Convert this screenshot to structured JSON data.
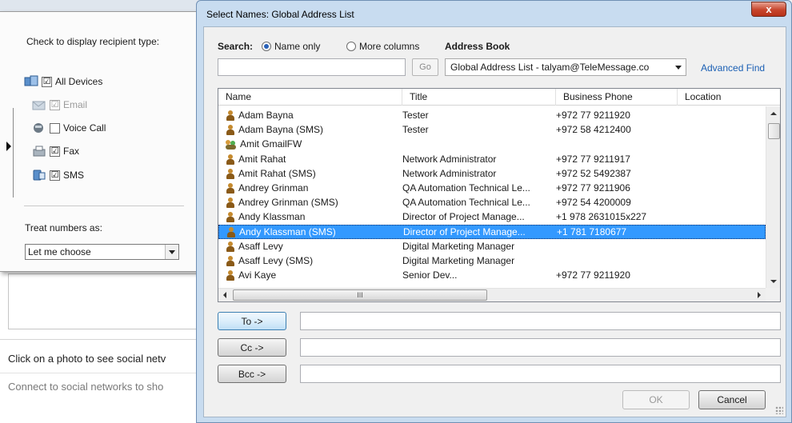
{
  "background": {
    "social_text": "Click on a photo to see social netv",
    "connect_text": "Connect to social networks to sho"
  },
  "recipient_popup": {
    "heading": "Check to display recipient type:",
    "types": [
      {
        "label": "All Devices",
        "checked": "☑",
        "icon": "devices-icon"
      },
      {
        "label": "Email",
        "checked": "☑",
        "icon": "email-icon",
        "dim": true
      },
      {
        "label": "Voice Call",
        "checked": "",
        "icon": "phone-icon"
      },
      {
        "label": "Fax",
        "checked": "☑",
        "icon": "fax-icon"
      },
      {
        "label": "SMS",
        "checked": "☑",
        "icon": "sms-icon"
      }
    ],
    "treat_label": "Treat numbers as:",
    "treat_value": "Let me choose"
  },
  "dialog": {
    "title": "Select Names: Global Address List",
    "close_label": "x",
    "search_label": "Search:",
    "radio_name_only": "Name only",
    "radio_more_columns": "More columns",
    "address_book_label": "Address Book",
    "search_value": "",
    "go_label": "Go",
    "address_book_value": "Global Address List - talyam@TeleMessage.co",
    "advanced_find": "Advanced Find",
    "columns": {
      "name": "Name",
      "title": "Title",
      "phone": "Business Phone",
      "location": "Location"
    },
    "rows": [
      {
        "name": "Adam Bayna",
        "title": "Tester",
        "phone": "+972 77 9211920",
        "location": "",
        "icon": "person"
      },
      {
        "name": "Adam Bayna (SMS)",
        "title": "Tester",
        "phone": "+972 58 4212400",
        "location": "",
        "icon": "person"
      },
      {
        "name": "Amit GmailFW",
        "title": "",
        "phone": "",
        "location": "",
        "icon": "group"
      },
      {
        "name": "Amit Rahat",
        "title": "Network Administrator",
        "phone": "+972 77 9211917",
        "location": "",
        "icon": "person"
      },
      {
        "name": "Amit Rahat (SMS)",
        "title": "Network Administrator",
        "phone": "+972 52 5492387",
        "location": "",
        "icon": "person"
      },
      {
        "name": "Andrey Grinman",
        "title": "QA Automation Technical Le...",
        "phone": "+972 77 9211906",
        "location": "",
        "icon": "person"
      },
      {
        "name": "Andrey Grinman (SMS)",
        "title": "QA Automation Technical Le...",
        "phone": "+972 54 4200009",
        "location": "",
        "icon": "person"
      },
      {
        "name": "Andy Klassman",
        "title": "Director of Project Manage...",
        "phone": "+1 978 2631015x227",
        "location": "",
        "icon": "person"
      },
      {
        "name": "Andy Klassman (SMS)",
        "title": "Director of Project Manage...",
        "phone": "+1 781 7180677",
        "location": "",
        "icon": "person",
        "selected": true
      },
      {
        "name": "Asaff Levy",
        "title": "Digital Marketing Manager",
        "phone": "",
        "location": "",
        "icon": "person"
      },
      {
        "name": "Asaff Levy (SMS)",
        "title": "Digital Marketing Manager",
        "phone": "",
        "location": "",
        "icon": "person"
      },
      {
        "name": "Avi Kaye",
        "title": "Senior Dev...",
        "phone": "+972 77 9211920",
        "location": "",
        "icon": "person"
      }
    ],
    "scroll_grip": "III",
    "to_label": "To ->",
    "cc_label": "Cc ->",
    "bcc_label": "Bcc ->",
    "to_value": "",
    "cc_value": "",
    "bcc_value": "",
    "ok_label": "OK",
    "cancel_label": "Cancel"
  }
}
